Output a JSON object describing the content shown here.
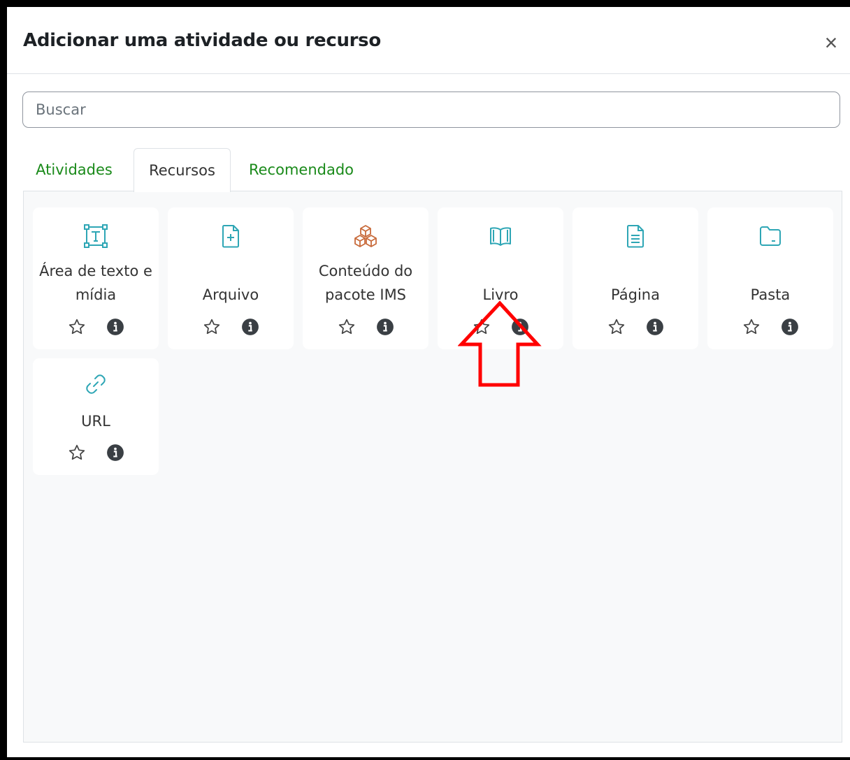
{
  "modal": {
    "title": "Adicionar uma atividade ou recurso",
    "close_symbol": "×"
  },
  "search": {
    "placeholder": "Buscar",
    "value": ""
  },
  "tabs": [
    {
      "label": "Atividades",
      "active": false
    },
    {
      "label": "Recursos",
      "active": true
    },
    {
      "label": "Recomendado",
      "active": false
    }
  ],
  "items": [
    {
      "label": "Área de texto e\nmídia",
      "icon": "text-box-icon",
      "color": "#2ea6b5"
    },
    {
      "label": "Arquivo",
      "icon": "file-add-icon",
      "color": "#2ea6b5"
    },
    {
      "label": "Conteúdo do\npacote IMS",
      "icon": "boxes-icon",
      "color": "#c86a3a"
    },
    {
      "label": "Livro",
      "icon": "book-icon",
      "color": "#2ea6b5"
    },
    {
      "label": "Página",
      "icon": "page-icon",
      "color": "#2ea6b5"
    },
    {
      "label": "Pasta",
      "icon": "folder-icon",
      "color": "#2ea6b5"
    },
    {
      "label": "URL",
      "icon": "link-icon",
      "color": "#2ea6b5"
    }
  ],
  "item_actions": {
    "star_icon": "star-outline-icon",
    "info_icon": "info-circle-icon"
  },
  "annotation": {
    "icon": "red-arrow-up-icon",
    "color": "#ff0000"
  }
}
